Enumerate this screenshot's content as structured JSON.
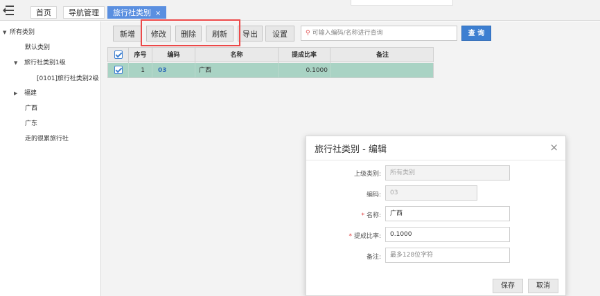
{
  "tabs": [
    {
      "label": "首页"
    },
    {
      "label": "导航管理"
    },
    {
      "label": "旅行社类别",
      "close": "×"
    }
  ],
  "tree": {
    "root": "所有类别",
    "items": [
      {
        "label": "默认类别"
      },
      {
        "label": "旅行社类别1级"
      },
      {
        "label": "[0101]旅行社类别2级"
      },
      {
        "label": "福建"
      },
      {
        "label": "广西"
      },
      {
        "label": "广东"
      },
      {
        "label": "走的很累旅行社"
      }
    ]
  },
  "toolbar": {
    "add": "新增",
    "edit": "修改",
    "delete": "删除",
    "refresh": "刷新",
    "export": "导出",
    "settings": "设置",
    "search_placeholder": "可输入编码/名称进行查询",
    "query": "查 询"
  },
  "table": {
    "headers": [
      "序号",
      "编码",
      "名称",
      "提成比率",
      "备注"
    ],
    "rows": [
      {
        "index": "1",
        "code": "03",
        "name": "广西",
        "rate": "0.1000",
        "note": ""
      }
    ]
  },
  "dialog": {
    "title": "旅行社类别 - 编辑",
    "close": "×",
    "parent_label": "上级类别:",
    "parent_value": "所有类别",
    "code_label": "编码:",
    "code_value": "03",
    "name_label": "名称:",
    "name_value": "广西",
    "rate_label": "提成比率:",
    "rate_value": "0.1000",
    "note_label": "备注:",
    "note_placeholder": "最多128位字符",
    "required_mark": "*",
    "save": "保存",
    "cancel": "取消"
  }
}
